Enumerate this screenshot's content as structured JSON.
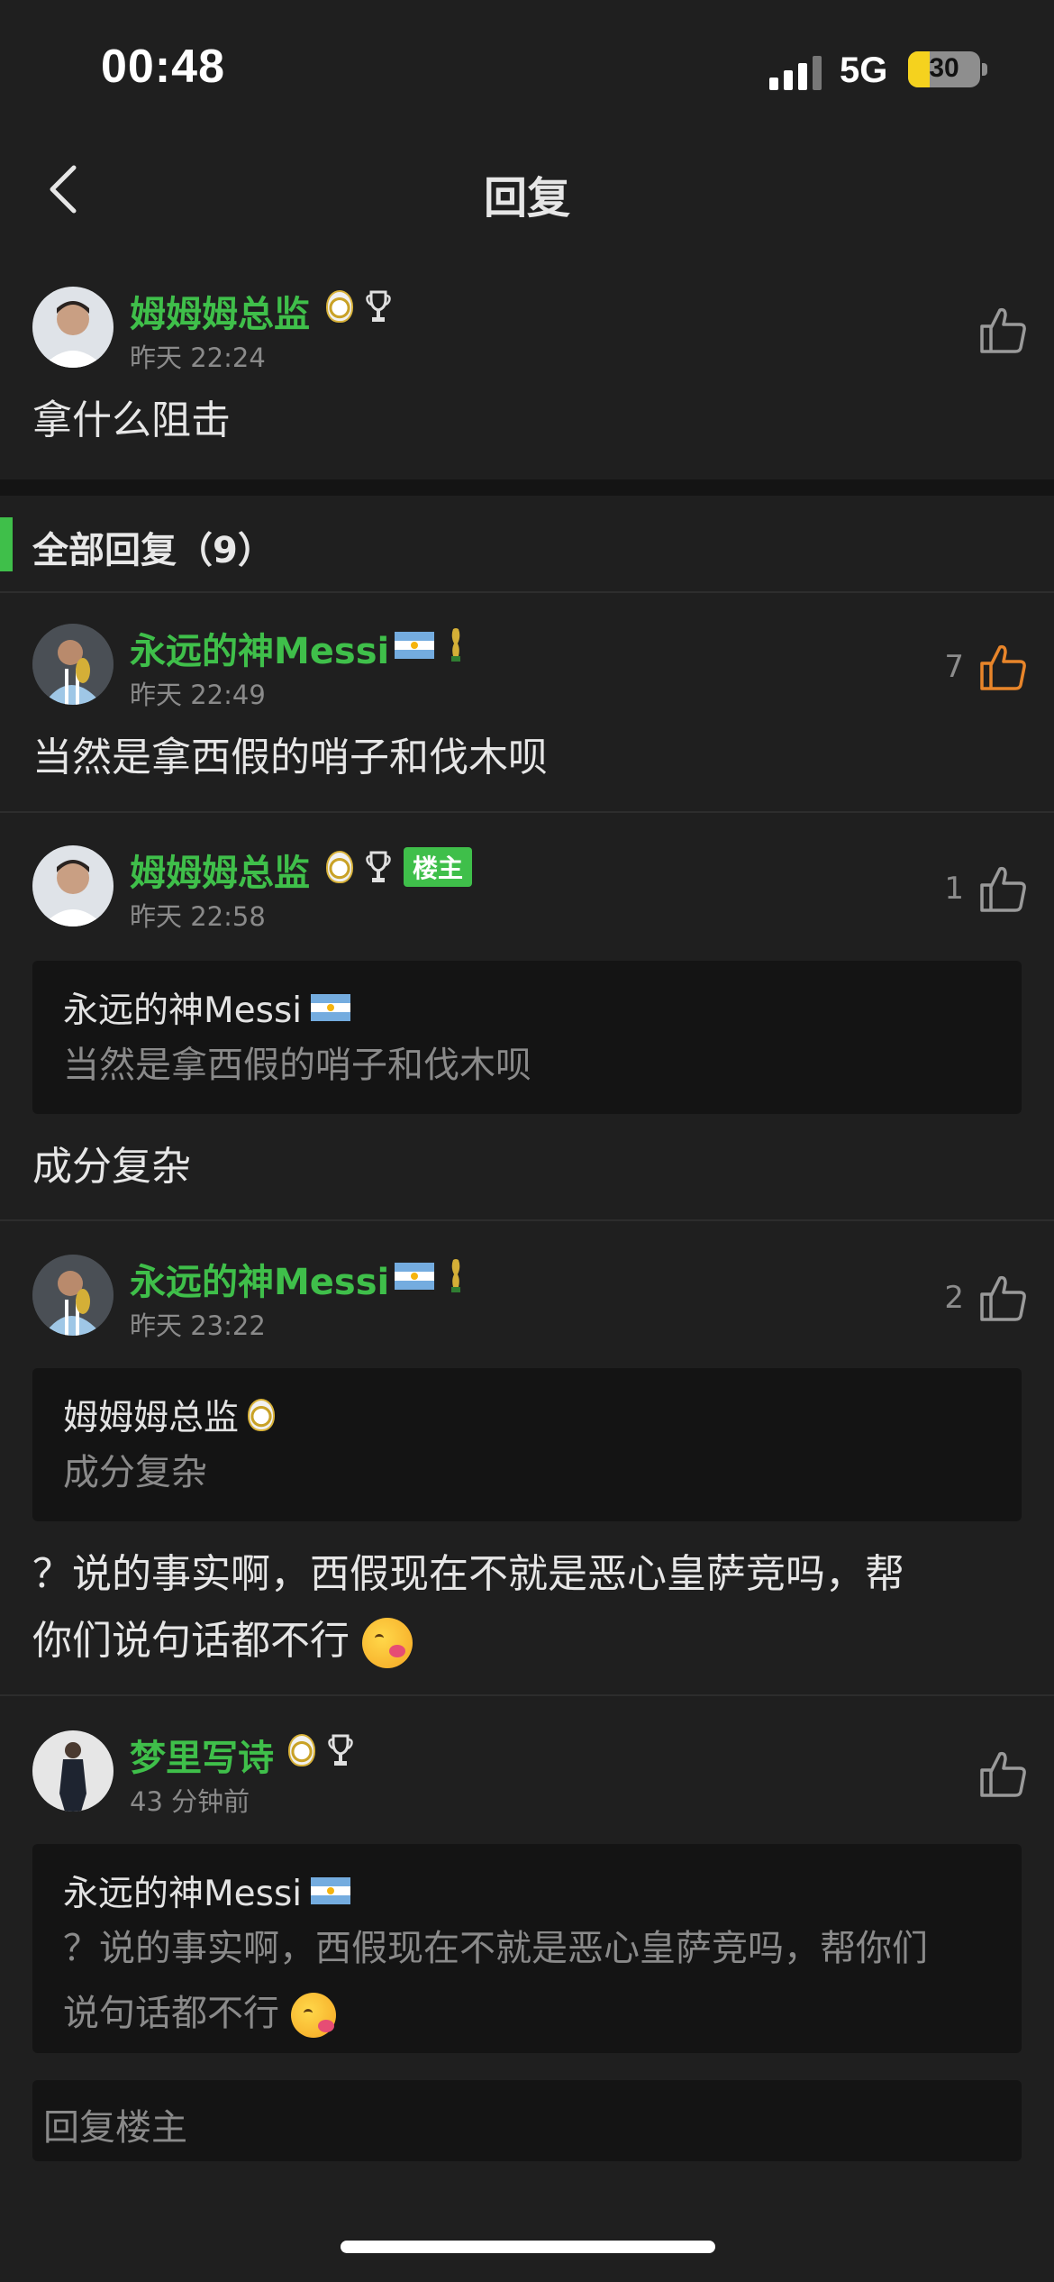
{
  "status_bar": {
    "time": "00:48",
    "network": "5G",
    "battery": "30",
    "battery_level": 0.3
  },
  "nav": {
    "title": "回复"
  },
  "main_comment": {
    "username": "姆姆姆总监",
    "time": "昨天 22:24",
    "text": "拿什么阻击",
    "badges": [
      "real-madrid-crest",
      "champions-league-trophy"
    ]
  },
  "section": {
    "title": "全部回复（9）"
  },
  "replies": [
    {
      "username": "永远的神Messi",
      "time": "昨天 22:49",
      "likes": "7",
      "liked": true,
      "badges": [
        "argentina-flag",
        "world-cup-trophy"
      ],
      "text": "当然是拿西假的哨子和伐木呗"
    },
    {
      "username": "姆姆姆总监",
      "time": "昨天 22:58",
      "likes": "1",
      "owner_tag": "楼主",
      "badges": [
        "real-madrid-crest",
        "champions-league-trophy"
      ],
      "quote": {
        "username": "永远的神Messi",
        "text": "当然是拿西假的哨子和伐木呗"
      },
      "text": "成分复杂"
    },
    {
      "username": "永远的神Messi",
      "time": "昨天 23:22",
      "likes": "2",
      "badges": [
        "argentina-flag",
        "world-cup-trophy"
      ],
      "quote": {
        "username": "姆姆姆总监",
        "text": "成分复杂"
      },
      "text_line1": "？说的事实啊，西假现在不就是恶心皇萨竞吗，帮",
      "text_line2": "你们说句话都不行"
    },
    {
      "username": "梦里写诗",
      "time": "43 分钟前",
      "likes": "",
      "badges": [
        "real-madrid-crest",
        "champions-league-trophy"
      ],
      "quote": {
        "username": "永远的神Messi",
        "text_line1": "？说的事实啊，西假现在不就是恶心皇萨竞吗，帮你们",
        "text_line2": "说句话都不行"
      }
    }
  ],
  "reply_input": {
    "placeholder": "回复楼主"
  },
  "colors": {
    "accent_green": "#3fbf4a",
    "liked_orange": "#e8852a",
    "background": "#1f1f1f"
  }
}
